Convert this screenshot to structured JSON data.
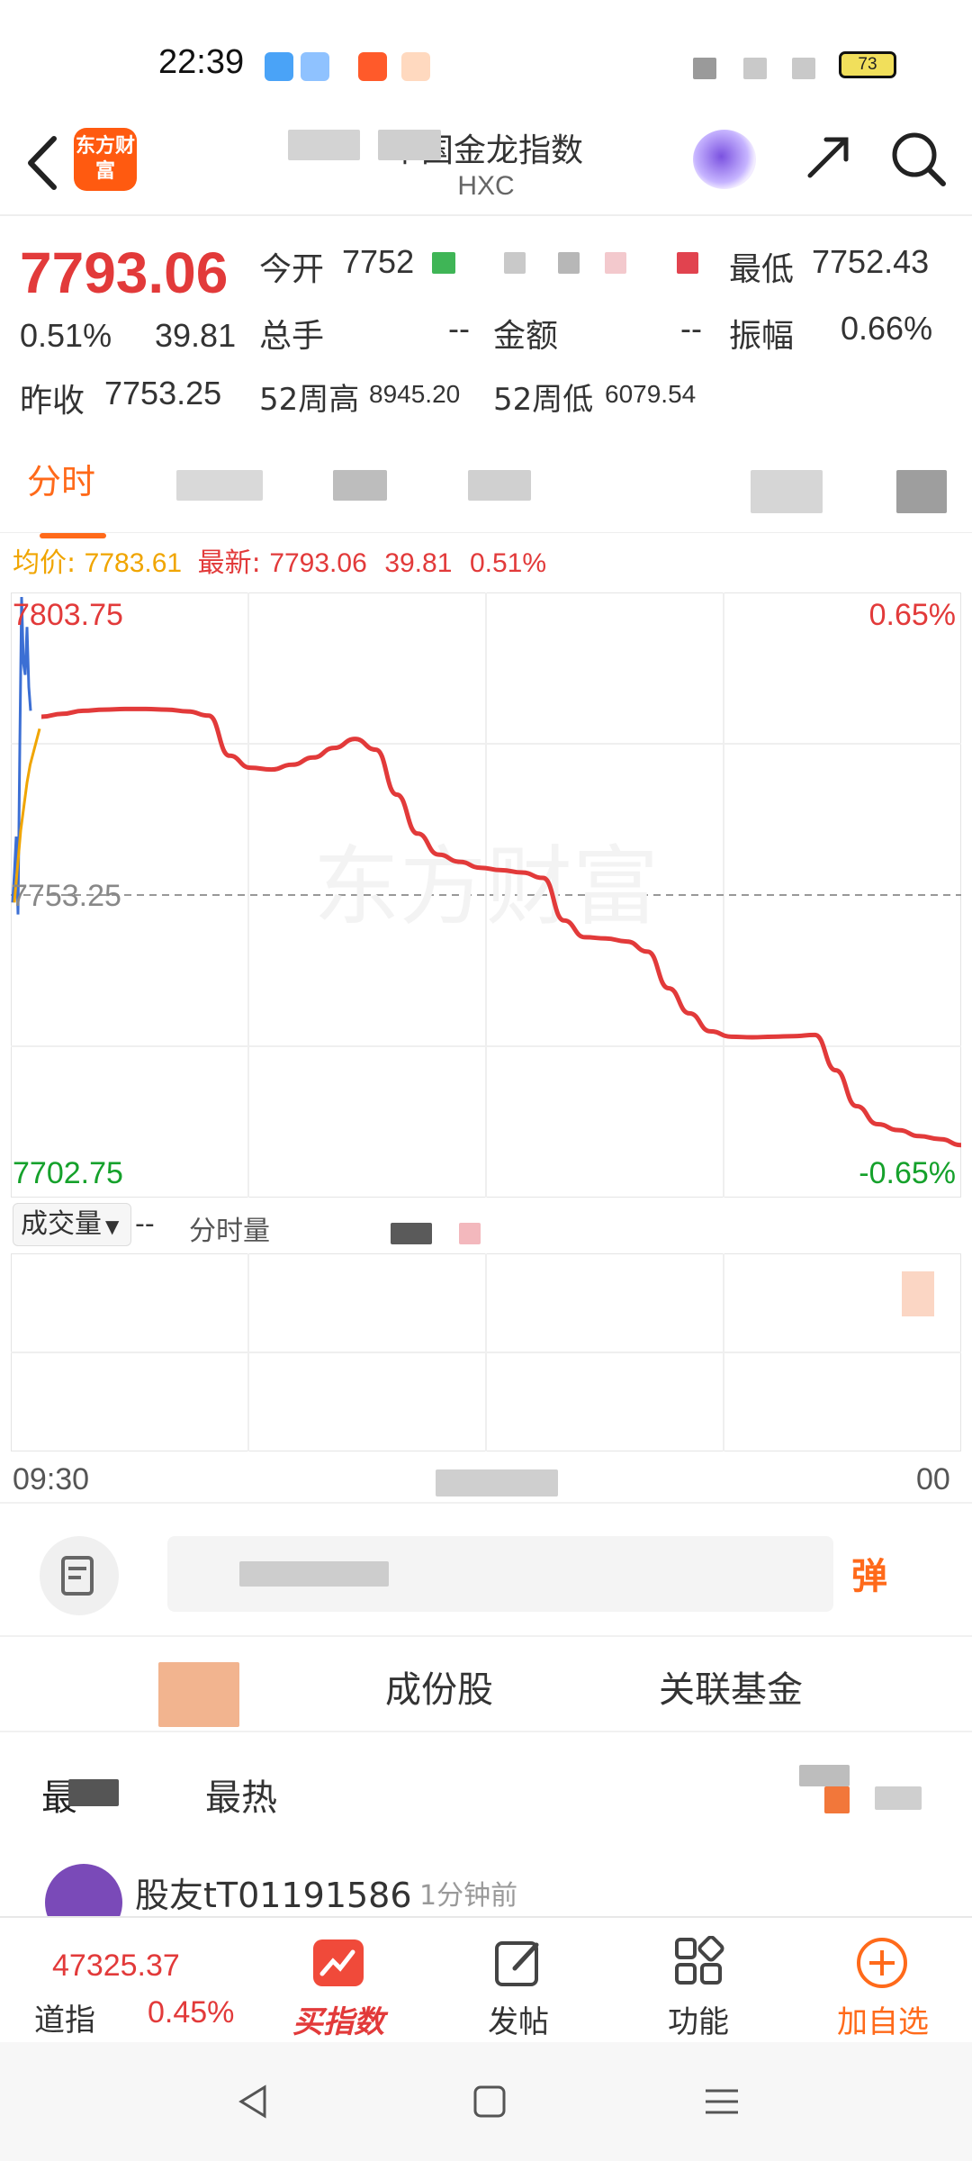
{
  "status_bar": {
    "time": "22:39",
    "battery": "73"
  },
  "header": {
    "logo_text": "东方财富",
    "title": "中国金龙指数",
    "subtitle": "HXC"
  },
  "quote": {
    "price": "7793.06",
    "change_pct": "0.51%",
    "change": "39.81",
    "open_label": "今开",
    "open_value": "7752",
    "low_label": "最低",
    "low_value": "7752.43",
    "volume_label": "总手",
    "volume_value": "--",
    "amount_label": "金额",
    "amount_value": "--",
    "amplitude_label": "振幅",
    "amplitude_value": "0.66%",
    "prev_close_label": "昨收",
    "prev_close_value": "7753.25",
    "high52_label": "52周高",
    "high52_value": "8945.20",
    "low52_label": "52周低",
    "low52_value": "6079.54"
  },
  "tabs": {
    "active": "分时"
  },
  "info_line": {
    "avg_label": "均价:",
    "avg_value": "7783.61",
    "latest_label": "最新:",
    "latest_value": "7793.06",
    "latest_change": "39.81",
    "latest_pct": "0.51%"
  },
  "chart_data": {
    "type": "line",
    "ylim": [
      7702.75,
      7803.75
    ],
    "reference": 7753.25,
    "y_top_label": "7803.75",
    "y_mid_label": "7753.25",
    "y_bottom_label": "7702.75",
    "pct_top_label": "0.65%",
    "pct_bottom_label": "-0.65%",
    "watermark": "东方财富",
    "x_start_label": "09:30",
    "x_end_label": "00",
    "series": [
      {
        "values": [
          7783,
          7783.5,
          7784,
          7784.2,
          7784.3,
          7784.3,
          7784.2,
          7783.9,
          7783.2,
          7776.5,
          7774.5,
          7774.2,
          7775.0,
          7776.2,
          7777.8,
          7779.3,
          7777.5,
          7770.0,
          7763.5,
          7760.0,
          7758.8,
          7757.8,
          7757.4,
          7757.0,
          7756.1,
          7749.0,
          7746.2,
          7746.0,
          7745.5,
          7743.8,
          7737.7,
          7733.5,
          7730.5,
          7729.6,
          7729.5,
          7729.6,
          7729.7,
          7729.9,
          7724.0,
          7718.0,
          7715.0,
          7714.0,
          7713.0,
          7712.5,
          7711.5
        ],
        "extra_start": [
          7752,
          7757,
          7763,
          7750,
          7778,
          7803,
          7792,
          7790,
          7798,
          7788,
          7784
        ]
      },
      {
        "values": [
          7752,
          7758,
          7764,
          7768,
          7772,
          7775,
          7777,
          7779,
          7781
        ]
      }
    ]
  },
  "volume": {
    "selector_label": "成交量",
    "selector_value": "--",
    "extra_label": "分时量"
  },
  "segments": [
    "成份股",
    "关联基金"
  ],
  "hot": {
    "latest_label": "最",
    "hot_label": "最热"
  },
  "post": {
    "user": "股友tT01191586",
    "time": "1分钟前"
  },
  "bottom_nav": {
    "index_value": "47325.37",
    "index_name": "道指",
    "index_pct": "0.45%",
    "buy_label": "买指数",
    "post_label": "发帖",
    "func_label": "功能",
    "add_label": "加自选"
  },
  "colors": {
    "up": "#e23a3a",
    "down": "#15a12b",
    "avg": "#f0a500",
    "accent": "#ff6a1a"
  }
}
